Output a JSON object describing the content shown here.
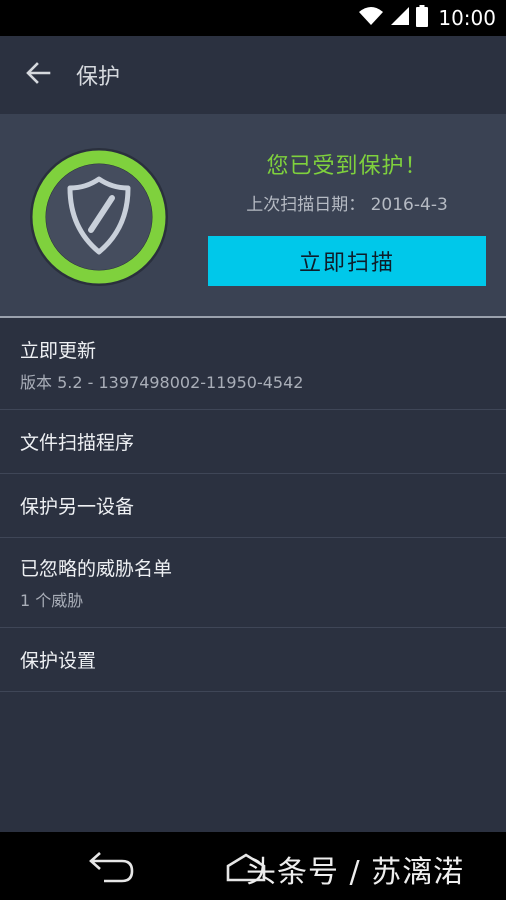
{
  "status_bar": {
    "time": "10:00",
    "icons": [
      "wifi-icon",
      "cell-signal-icon",
      "battery-icon"
    ]
  },
  "app_bar": {
    "title": "保护",
    "back_icon": "arrow-back-icon"
  },
  "hero": {
    "status_title": "您已受到保护！",
    "last_scan": "上次扫描日期： 2016-4-3",
    "scan_button_label": "立即扫描",
    "shield_icon": "shield-icon",
    "ring_color": "#7fd13d",
    "button_color": "#00c8ea"
  },
  "menu": {
    "items": [
      {
        "primary": "立即更新",
        "secondary": "版本 5.2 - 1397498002-11950-4542"
      },
      {
        "primary": "文件扫描程序",
        "secondary": ""
      },
      {
        "primary": "保护另一设备",
        "secondary": ""
      },
      {
        "primary": "已忽略的威胁名单",
        "secondary": "1 个威胁"
      },
      {
        "primary": "保护设置",
        "secondary": ""
      }
    ]
  },
  "nav_bar": {
    "icons": [
      "nav-back-icon",
      "nav-home-icon"
    ],
    "watermark": "头条号 / 苏漓渃"
  }
}
